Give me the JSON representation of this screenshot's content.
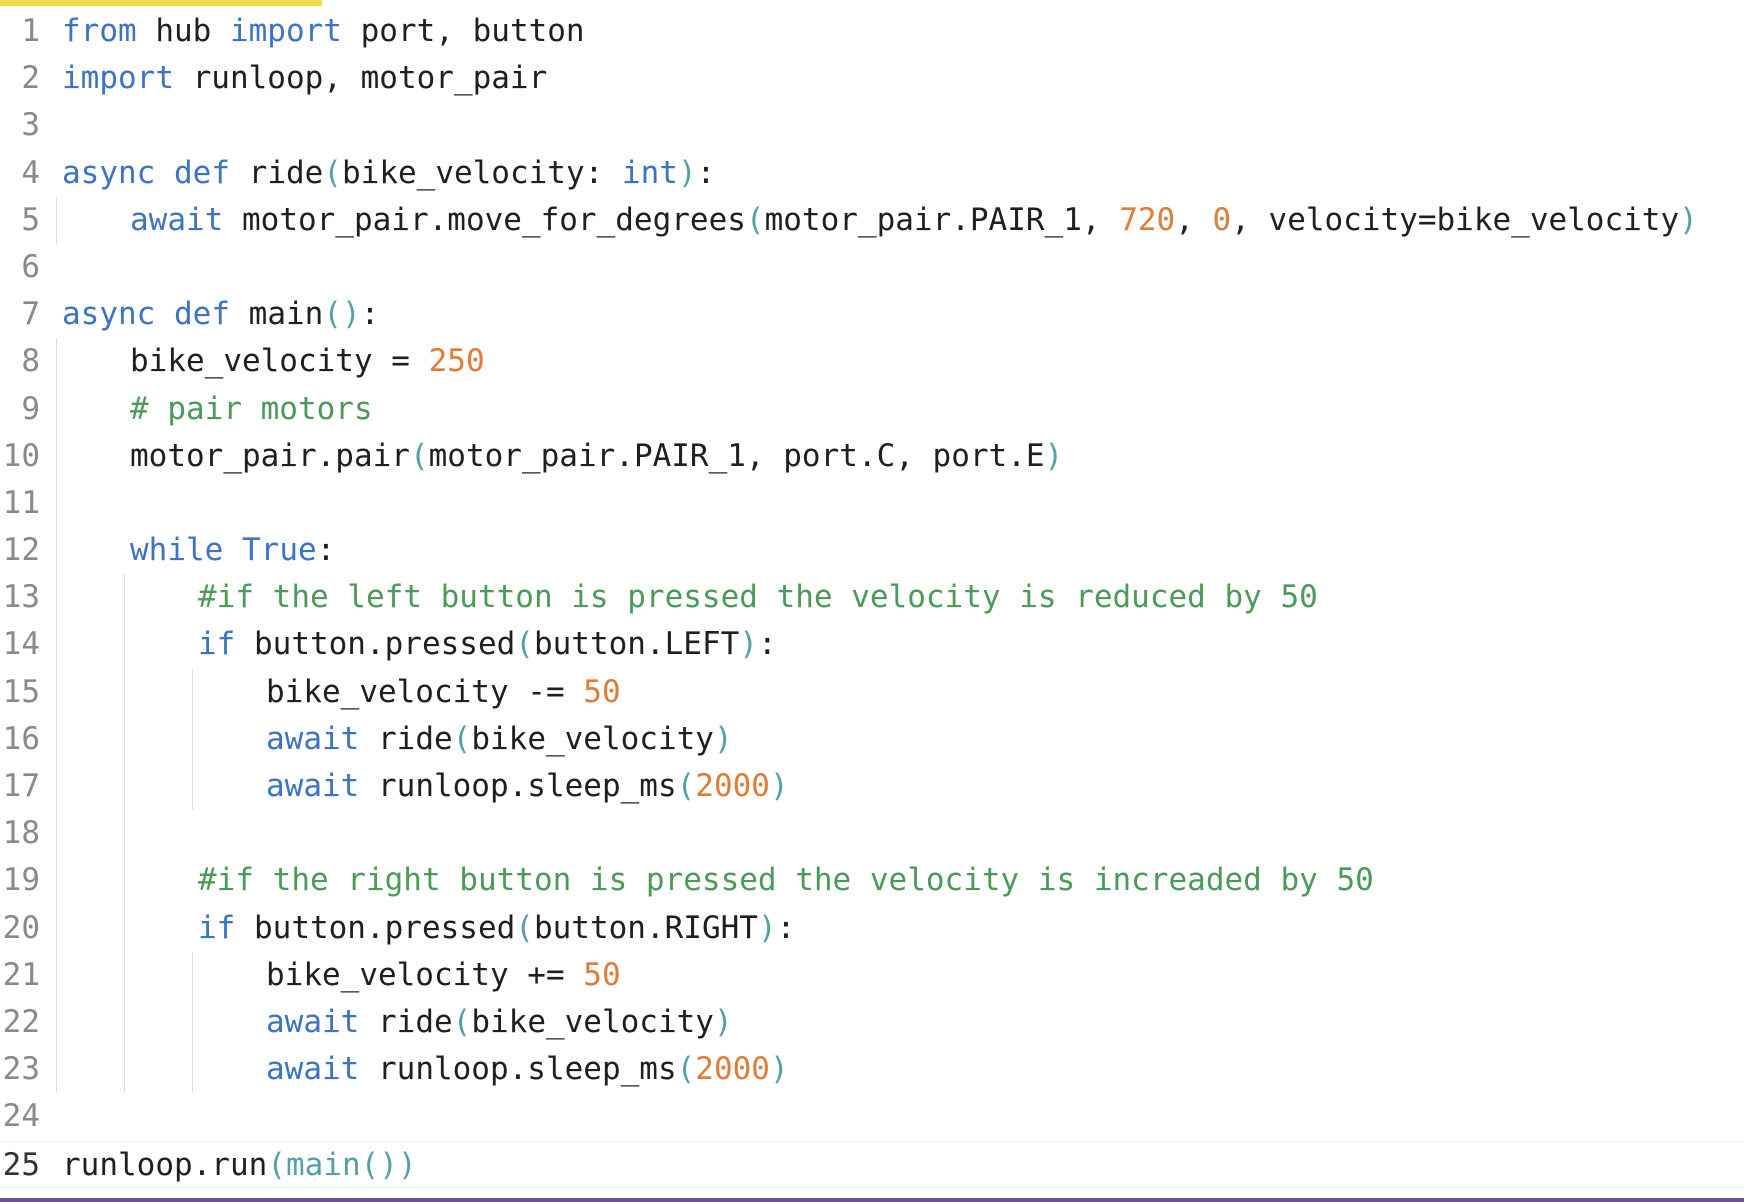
{
  "editor": {
    "lines": [
      {
        "number": "1",
        "tokens": [
          [
            "kw",
            "from"
          ],
          [
            "pl",
            " hub "
          ],
          [
            "kw",
            "import"
          ],
          [
            "pl",
            " port, button"
          ]
        ]
      },
      {
        "number": "2",
        "tokens": [
          [
            "kw",
            "import"
          ],
          [
            "pl",
            " runloop, motor_pair"
          ]
        ]
      },
      {
        "number": "3",
        "tokens": []
      },
      {
        "number": "4",
        "tokens": [
          [
            "kw",
            "async"
          ],
          [
            "pl",
            " "
          ],
          [
            "kw",
            "def"
          ],
          [
            "pl",
            " ride"
          ],
          [
            "paren",
            "("
          ],
          [
            "pl",
            "bike_velocity: "
          ],
          [
            "kw",
            "int"
          ],
          [
            "paren",
            ")"
          ],
          [
            "pl",
            ":"
          ]
        ]
      },
      {
        "number": "5",
        "indent": 1,
        "tokens": [
          [
            "kw",
            "await"
          ],
          [
            "pl",
            " motor_pair.move_for_degrees"
          ],
          [
            "paren",
            "("
          ],
          [
            "pl",
            "motor_pair.PAIR_1, "
          ],
          [
            "num",
            "720"
          ],
          [
            "pl",
            ", "
          ],
          [
            "num",
            "0"
          ],
          [
            "pl",
            ", velocity=bike_velocity"
          ],
          [
            "paren",
            ")"
          ]
        ]
      },
      {
        "number": "6",
        "tokens": []
      },
      {
        "number": "7",
        "tokens": [
          [
            "kw",
            "async"
          ],
          [
            "pl",
            " "
          ],
          [
            "kw",
            "def"
          ],
          [
            "pl",
            " main"
          ],
          [
            "paren",
            "()"
          ],
          [
            "pl",
            ":"
          ]
        ]
      },
      {
        "number": "8",
        "indent": 1,
        "tokens": [
          [
            "pl",
            "bike_velocity = "
          ],
          [
            "num",
            "250"
          ]
        ]
      },
      {
        "number": "9",
        "indent": 1,
        "tokens": [
          [
            "cm",
            "# pair motors"
          ]
        ]
      },
      {
        "number": "10",
        "indent": 1,
        "tokens": [
          [
            "pl",
            "motor_pair.pair"
          ],
          [
            "paren",
            "("
          ],
          [
            "pl",
            "motor_pair.PAIR_1, port.C, port.E"
          ],
          [
            "paren",
            ")"
          ]
        ]
      },
      {
        "number": "11",
        "tokens": []
      },
      {
        "number": "12",
        "indent": 1,
        "tokens": [
          [
            "kw",
            "while"
          ],
          [
            "pl",
            " "
          ],
          [
            "kw",
            "True"
          ],
          [
            "pl",
            ":"
          ]
        ]
      },
      {
        "number": "13",
        "indent": 2,
        "tokens": [
          [
            "cm",
            "#if the left button is pressed the velocity is reduced by 50"
          ]
        ]
      },
      {
        "number": "14",
        "indent": 2,
        "tokens": [
          [
            "kw",
            "if"
          ],
          [
            "pl",
            " button.pressed"
          ],
          [
            "paren",
            "("
          ],
          [
            "pl",
            "button.LEFT"
          ],
          [
            "paren",
            ")"
          ],
          [
            "pl",
            ":"
          ]
        ]
      },
      {
        "number": "15",
        "indent": 3,
        "tokens": [
          [
            "pl",
            "bike_velocity -= "
          ],
          [
            "num",
            "50"
          ]
        ]
      },
      {
        "number": "16",
        "indent": 3,
        "tokens": [
          [
            "kw",
            "await"
          ],
          [
            "pl",
            " ride"
          ],
          [
            "paren",
            "("
          ],
          [
            "pl",
            "bike_velocity"
          ],
          [
            "paren",
            ")"
          ]
        ]
      },
      {
        "number": "17",
        "indent": 3,
        "tokens": [
          [
            "kw",
            "await"
          ],
          [
            "pl",
            " runloop.sleep_ms"
          ],
          [
            "paren",
            "("
          ],
          [
            "num",
            "2000"
          ],
          [
            "paren",
            ")"
          ]
        ]
      },
      {
        "number": "18",
        "tokens": []
      },
      {
        "number": "19",
        "indent": 2,
        "tokens": [
          [
            "cm",
            "#if the right button is pressed the velocity is increaded by 50"
          ]
        ]
      },
      {
        "number": "20",
        "indent": 2,
        "tokens": [
          [
            "kw",
            "if"
          ],
          [
            "pl",
            " button.pressed"
          ],
          [
            "paren",
            "("
          ],
          [
            "pl",
            "button.RIGHT"
          ],
          [
            "paren",
            ")"
          ],
          [
            "pl",
            ":"
          ]
        ]
      },
      {
        "number": "21",
        "indent": 3,
        "tokens": [
          [
            "pl",
            "bike_velocity += "
          ],
          [
            "num",
            "50"
          ]
        ]
      },
      {
        "number": "22",
        "indent": 3,
        "tokens": [
          [
            "kw",
            "await"
          ],
          [
            "pl",
            " ride"
          ],
          [
            "paren",
            "("
          ],
          [
            "pl",
            "bike_velocity"
          ],
          [
            "paren",
            ")"
          ]
        ]
      },
      {
        "number": "23",
        "indent": 3,
        "tokens": [
          [
            "kw",
            "await"
          ],
          [
            "pl",
            " runloop.sleep_ms"
          ],
          [
            "paren",
            "("
          ],
          [
            "num",
            "2000"
          ],
          [
            "paren",
            ")"
          ]
        ]
      },
      {
        "number": "24",
        "tokens": []
      },
      {
        "number": "25",
        "active": true,
        "tokens": [
          [
            "pl",
            "runloop.run"
          ],
          [
            "paren",
            "(main())"
          ]
        ]
      }
    ]
  },
  "colors": {
    "keyword": "#3d73c5",
    "number": "#e07c35",
    "comment": "#4c9a5a",
    "paren": "#53a1a6",
    "plain": "#1f1f1f",
    "line_number": "#8a8a8a",
    "top_accent": "#f2d94e",
    "bottom_bar": "#6f4f9a"
  }
}
